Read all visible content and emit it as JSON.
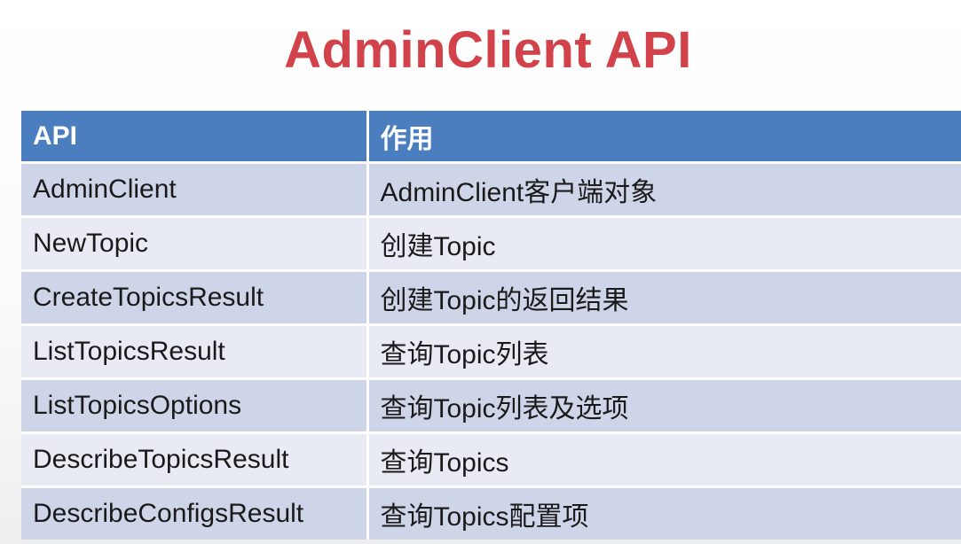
{
  "slide": {
    "title": "AdminClient API"
  },
  "table": {
    "headers": [
      "API",
      "作用"
    ],
    "rows": [
      [
        "AdminClient",
        "AdminClient客户端对象"
      ],
      [
        "NewTopic",
        "创建Topic"
      ],
      [
        "CreateTopicsResult",
        "创建Topic的返回结果"
      ],
      [
        "ListTopicsResult",
        "查询Topic列表"
      ],
      [
        "ListTopicsOptions",
        "查询Topic列表及选项"
      ],
      [
        "DescribeTopicsResult",
        "查询Topics"
      ],
      [
        "DescribeConfigsResult",
        "查询Topics配置项"
      ]
    ]
  },
  "colors": {
    "title": "#d2424a",
    "header_bg": "#4a7ebf",
    "row_dark": "#cfd5e8",
    "row_light": "#e8ebf4"
  }
}
